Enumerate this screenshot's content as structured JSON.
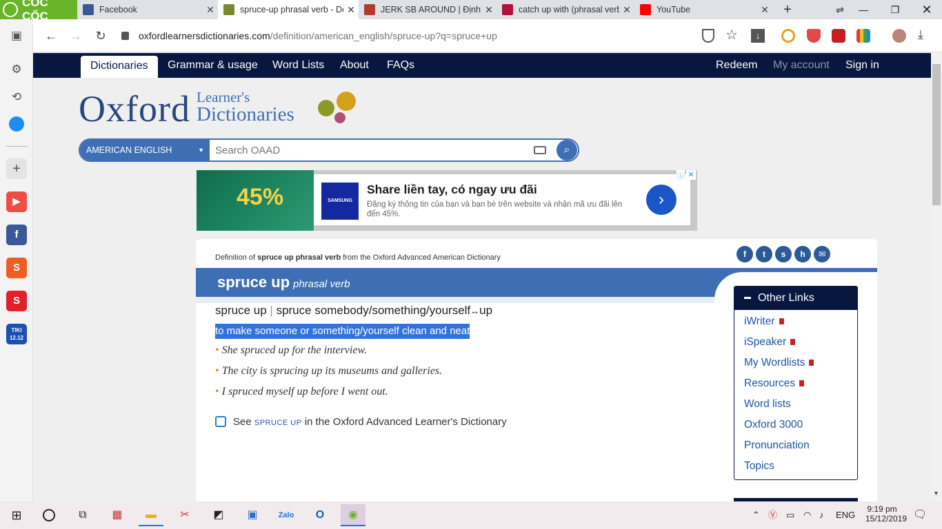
{
  "browser": {
    "brand": "CỐC CỐC",
    "tabs": [
      {
        "title": "Facebook",
        "icon": "facebook-icon",
        "color": "#3b5998",
        "active": false
      },
      {
        "title": "spruce-up phrasal verb - De",
        "icon": "oxford-icon",
        "color": "#7a8a2a",
        "active": true
      },
      {
        "title": "JERK SB AROUND | Định ng",
        "icon": "cambridge-icon",
        "color": "#b03a2e",
        "active": false
      },
      {
        "title": "catch up with (phrasal verb)",
        "icon": "book-icon",
        "color": "#b3123c",
        "active": false
      },
      {
        "title": "YouTube",
        "icon": "youtube-icon",
        "color": "#ff0000",
        "active": false
      }
    ],
    "new_tab": "+",
    "url_domain": "oxfordlearnersdictionaries.com",
    "url_path": "/definition/american_english/spruce-up?q=spruce+up"
  },
  "sidebar_apps": [
    {
      "name": "youtube",
      "label": "▶",
      "color": "#f04e45"
    },
    {
      "name": "facebook",
      "label": "f",
      "color": "#3b5998"
    },
    {
      "name": "shopee",
      "label": "S",
      "color": "#f05d23"
    },
    {
      "name": "sendo",
      "label": "S",
      "color": "#e02128"
    },
    {
      "name": "tiki",
      "label": "TIKI 12.12",
      "color": "#1a4fb5"
    }
  ],
  "nav": {
    "left": [
      "Dictionaries",
      "Grammar & usage",
      "Word Lists",
      "About",
      "FAQs"
    ],
    "right": [
      "Redeem",
      "My account",
      "Sign in"
    ]
  },
  "logo": {
    "word": "Oxford",
    "line1": "Learner's",
    "line2": "Dictionaries"
  },
  "search": {
    "dialect": "AMERICAN ENGLISH",
    "placeholder": "Search OAAD"
  },
  "ad": {
    "left_text": "45%",
    "headline": "Share liền tay, có ngay ưu đãi",
    "body": "Đăng ký thông tin của bạn và bạn bè trên website và nhận mã ưu đãi lên đến 45%.",
    "brand": "SAMSUNG"
  },
  "entry": {
    "source_prefix": "Definition of ",
    "source_word": "spruce up phrasal verb",
    "source_suffix": " from the Oxford Advanced American Dictionary",
    "headword": "spruce up",
    "pos": "phrasal verb",
    "forms_a": "spruce up",
    "forms_sep": "|",
    "forms_b": "spruce somebody/something/yourself",
    "forms_arrow": "↔",
    "forms_c": "up",
    "definition": "to make someone or something/yourself clean and neat",
    "examples": [
      "She spruced up for the interview.",
      "The city is sprucing up its museums and galleries.",
      "I spruced myself up before I went out."
    ],
    "see_prefix": "See ",
    "see_word": "spruce up",
    "see_suffix": " in the Oxford Advanced Learner's Dictionary"
  },
  "other_links": {
    "title": "Other Links",
    "items": [
      {
        "label": "iWriter",
        "locked": true
      },
      {
        "label": "iSpeaker",
        "locked": true
      },
      {
        "label": "My Wordlists",
        "locked": true
      },
      {
        "label": "Resources",
        "locked": true
      },
      {
        "label": "Word lists",
        "locked": false
      },
      {
        "label": "Oxford 3000",
        "locked": false
      },
      {
        "label": "Pronunciation",
        "locked": false
      },
      {
        "label": "Topics",
        "locked": false
      }
    ]
  },
  "taskbar": {
    "lang": "ENG",
    "time": "9:19 pm",
    "date": "15/12/2019"
  },
  "colors": {
    "navy": "#07173f",
    "oxford_blue": "#3e6fb5",
    "link": "#1f55a2",
    "highlight": "#3174d9"
  }
}
